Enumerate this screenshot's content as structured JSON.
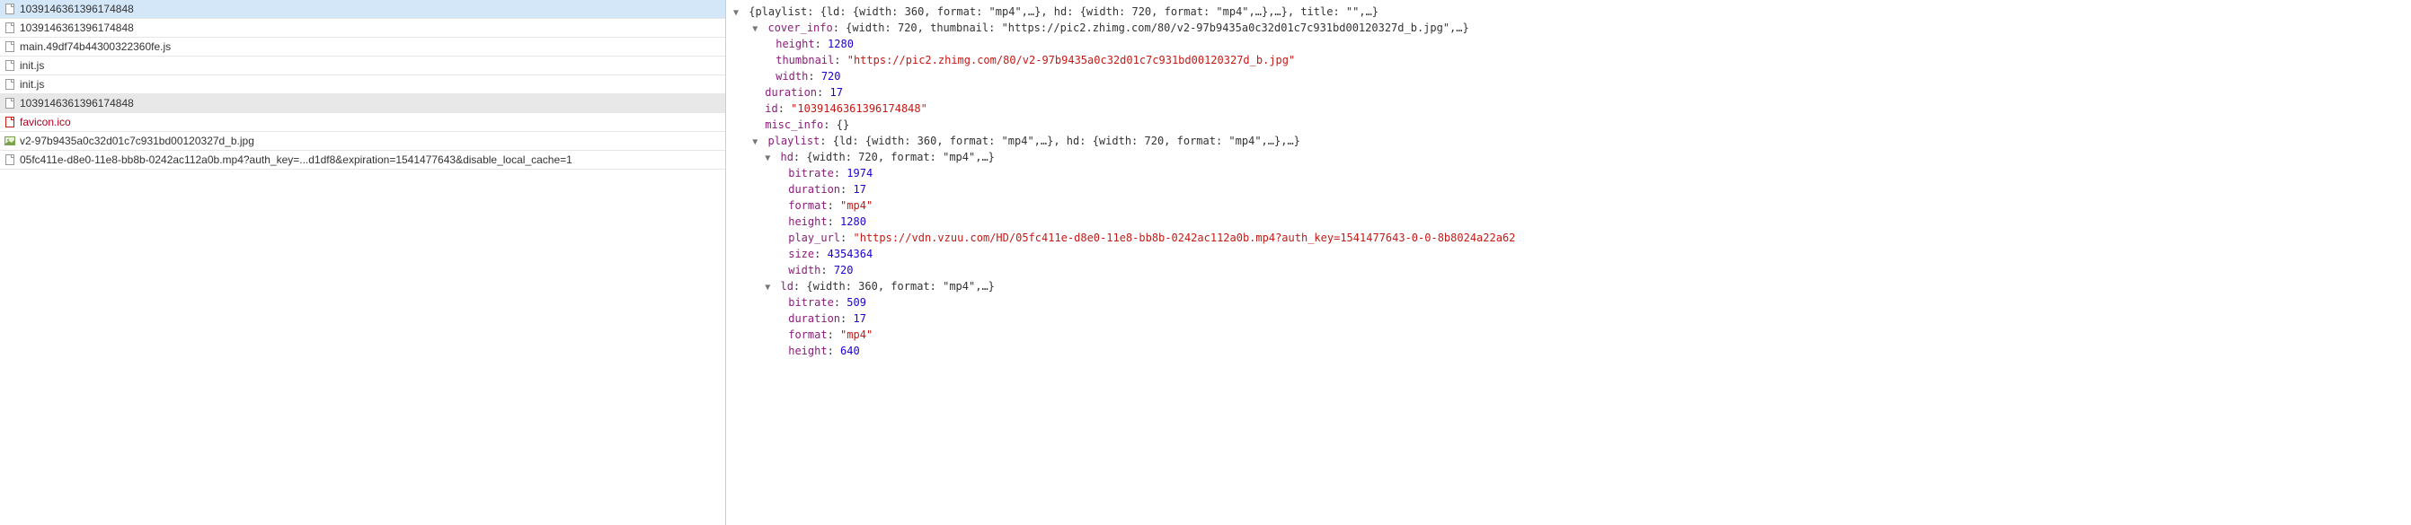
{
  "network": {
    "rows": [
      {
        "name": "1039146361396174848",
        "icon": "document",
        "state": "selected"
      },
      {
        "name": "1039146361396174848",
        "icon": "document",
        "state": ""
      },
      {
        "name": "main.49df74b44300322360fe.js",
        "icon": "document",
        "state": ""
      },
      {
        "name": "init.js",
        "icon": "document",
        "state": ""
      },
      {
        "name": "init.js",
        "icon": "document",
        "state": ""
      },
      {
        "name": "1039146361396174848",
        "icon": "document",
        "state": "highlighted"
      },
      {
        "name": "favicon.ico",
        "icon": "document-red",
        "state": "favicon-special"
      },
      {
        "name": "v2-97b9435a0c32d01c7c931bd00120327d_b.jpg",
        "icon": "image",
        "state": ""
      },
      {
        "name": "05fc411e-d8e0-11e8-bb8b-0242ac112a0b.mp4?auth_key=...d1df8&expiration=1541477643&disable_local_cache=1",
        "icon": "document",
        "state": ""
      }
    ]
  },
  "json_preview": {
    "root_summary_prefix": "{playlist: {ld: {width: 360, format: \"mp4\",…}, hd: {width: 720, format: \"mp4\",…},…}, title: \"\",…}",
    "cover_info": {
      "key": "cover_info",
      "summary": "{width: 720, thumbnail: \"https://pic2.zhimg.com/80/v2-97b9435a0c32d01c7c931bd00120327d_b.jpg\",…}",
      "height_key": "height",
      "height_val": "1280",
      "thumbnail_key": "thumbnail",
      "thumbnail_val": "\"https://pic2.zhimg.com/80/v2-97b9435a0c32d01c7c931bd00120327d_b.jpg\"",
      "width_key": "width",
      "width_val": "720"
    },
    "duration_key": "duration",
    "duration_val": "17",
    "id_key": "id",
    "id_val": "\"1039146361396174848\"",
    "misc_key": "misc_info",
    "misc_val": "{}",
    "playlist": {
      "key": "playlist",
      "summary": "{ld: {width: 360, format: \"mp4\",…}, hd: {width: 720, format: \"mp4\",…},…}",
      "hd": {
        "key": "hd",
        "summary": "{width: 720, format: \"mp4\",…}",
        "bitrate_key": "bitrate",
        "bitrate_val": "1974",
        "duration_key": "duration",
        "duration_val": "17",
        "format_key": "format",
        "format_val": "\"mp4\"",
        "height_key": "height",
        "height_val": "1280",
        "play_url_key": "play_url",
        "play_url_val": "\"https://vdn.vzuu.com/HD/05fc411e-d8e0-11e8-bb8b-0242ac112a0b.mp4?auth_key=1541477643-0-0-8b8024a22a62",
        "size_key": "size",
        "size_val": "4354364",
        "width_key": "width",
        "width_val": "720"
      },
      "ld": {
        "key": "ld",
        "summary": "{width: 360, format: \"mp4\",…}",
        "bitrate_key": "bitrate",
        "bitrate_val": "509",
        "duration_key": "duration",
        "duration_val": "17",
        "format_key": "format",
        "format_val": "\"mp4\"",
        "height_key": "height",
        "height_val": "640"
      }
    }
  }
}
